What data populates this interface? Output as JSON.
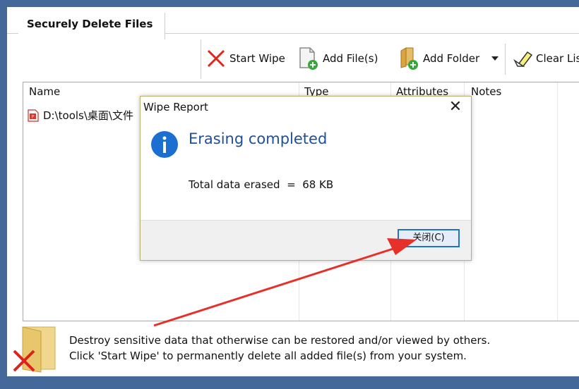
{
  "app": {
    "tab_title": "Securely Delete Files"
  },
  "toolbar": {
    "start_wipe": "Start Wipe",
    "add_files": "Add File(s)",
    "add_folder": "Add Folder",
    "clear_list": "Clear Lis"
  },
  "file_list": {
    "columns": [
      "Name",
      "Type",
      "Attributes",
      "Notes"
    ],
    "rows": [
      {
        "name": "D:\\tools\\桌面\\文件",
        "icon": "pdf-file-icon"
      }
    ]
  },
  "footer": {
    "line1": "Destroy sensitive data that otherwise can be restored and/or viewed by others.",
    "line2": "Click 'Start Wipe' to permanently delete all added file(s) from your system."
  },
  "dialog": {
    "title": "Wipe Report",
    "heading": "Erasing completed",
    "message_label": "Total data erased",
    "message_sep": "=",
    "message_value": "68 KB",
    "close_button": "关闭(C)"
  },
  "colors": {
    "desktop": "#45689a",
    "heading": "#1c4fa0",
    "annotation_arrow": "#e8302a"
  },
  "icons": [
    "red-x-icon",
    "add-file-icon",
    "add-folder-icon",
    "dropdown-arrow-icon",
    "eraser-icon",
    "info-icon",
    "close-icon",
    "folder-delete-icon",
    "red-arrow-annotation"
  ]
}
